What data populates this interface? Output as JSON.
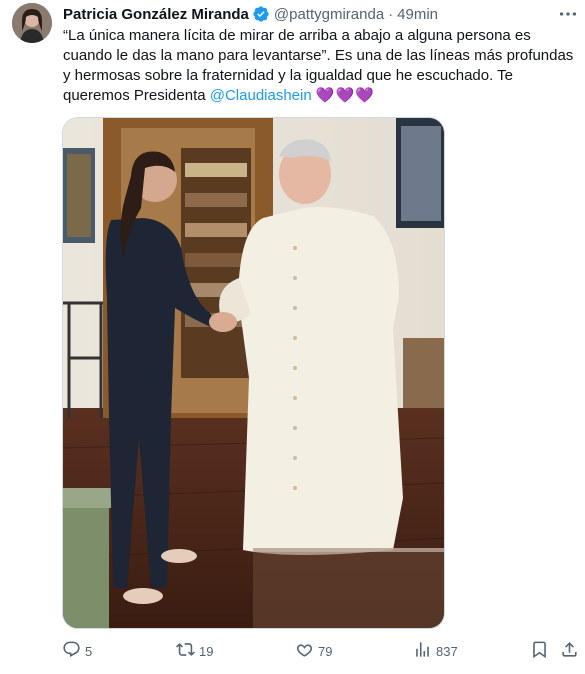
{
  "tweet": {
    "author_name": "Patricia González Miranda",
    "handle": "@pattygmiranda",
    "separator": "·",
    "time": "49min",
    "text_main": "“La única manera lícita de mirar de arriba a abajo a alguna persona es cuando le das la mano para levantarse”. Es una de las líneas más profundas y hermosas sobre la fraternidad y la igualdad que he escuchado. Te queremos Presidenta ",
    "mention": "@Claudiashein",
    "emoji": "💜💜💜"
  },
  "actions": {
    "replies": "5",
    "retweets": "19",
    "likes": "79",
    "views": "837"
  },
  "icons": {
    "verified": "verified-badge-icon",
    "more": "more-options-icon",
    "reply": "reply-icon",
    "retweet": "retweet-icon",
    "like": "heart-icon",
    "views": "analytics-icon",
    "bookmark": "bookmark-icon",
    "share": "share-icon"
  },
  "colors": {
    "accent": "#1d9bf0",
    "text": "#0f1419",
    "secondary": "#536471"
  }
}
